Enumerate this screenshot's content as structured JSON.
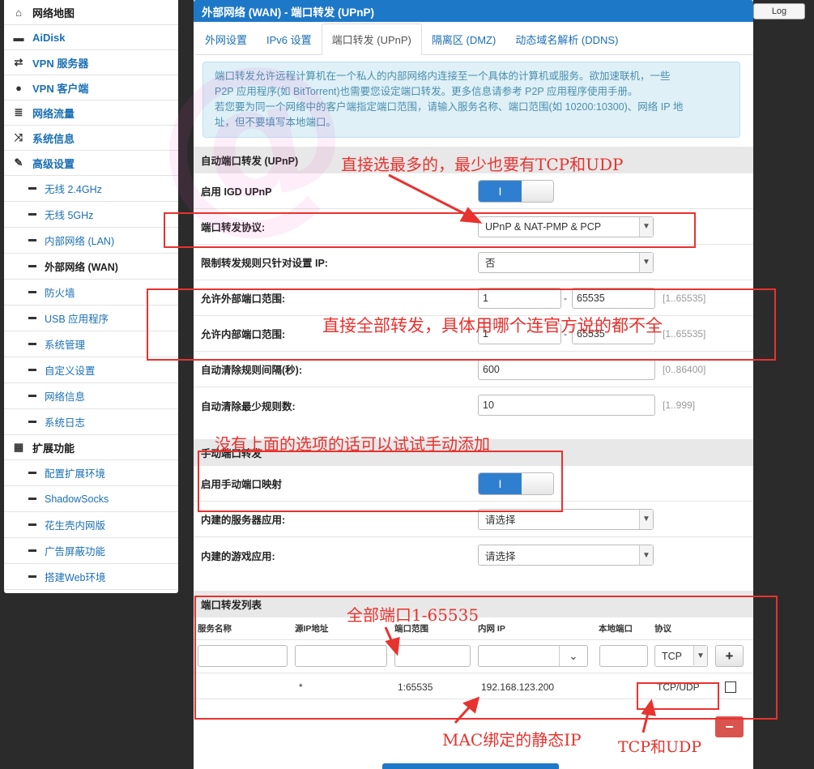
{
  "header": {
    "title": "外部网络 (WAN) - 端口转发 (UPnP)",
    "logout_label": "Log"
  },
  "sidebar": {
    "items": [
      {
        "icon": "home-icon",
        "label": "网络地图"
      },
      {
        "icon": "drive-icon",
        "label": "AiDisk"
      },
      {
        "icon": "vpn-icon",
        "label": "VPN 服务器"
      },
      {
        "icon": "globe-icon",
        "label": "VPN 客户端"
      },
      {
        "icon": "traffic-icon",
        "label": "网络流量"
      },
      {
        "icon": "shuffle-icon",
        "label": "系统信息"
      },
      {
        "icon": "wrench-icon",
        "label": "高级设置"
      }
    ],
    "advanced_sub": [
      "无线 2.4GHz",
      "无线 5GHz",
      "内部网络 (LAN)",
      "外部网络 (WAN)",
      "防火墙",
      "USB 应用程序",
      "系统管理",
      "自定义设置",
      "网络信息",
      "系统日志"
    ],
    "ext_label": "扩展功能",
    "ext_sub": [
      "配置扩展环境",
      "ShadowSocks",
      "花生壳内网版",
      "广告屏蔽功能",
      "搭建Web环境"
    ]
  },
  "tabs": [
    "外网设置",
    "IPv6 设置",
    "端口转发 (UPnP)",
    "隔离区 (DMZ)",
    "动态域名解析 (DDNS)"
  ],
  "info": {
    "line1": "端口转发允许远程计算机在一个私人的内部网络内连接至一个具体的计算机或服务。欲加速联机，一些",
    "line2": "P2P 应用程序(如 BitTorrent)也需要您设定端口转发。更多信息请参考 P2P 应用程序使用手册。",
    "line3": "若您要为同一个网络中的客户端指定端口范围，请输入服务名称、端口范围(如 10200:10300)、网络 IP 地",
    "line4": "址，但不要填写本地端口。"
  },
  "upnp": {
    "section": "自动端口转发 (UPnP)",
    "enable_label": "启用 IGD UPnP",
    "toggle_on": "I",
    "protocol_label": "端口转发协议:",
    "protocol_value": "UPnP & NAT-PMP & PCP",
    "restrict_label": "限制转发规则只针对设置 IP:",
    "restrict_value": "否",
    "ext_range_label": "允许外部端口范围:",
    "ext_from": "1",
    "ext_to": "65535",
    "int_range_label": "允许内部端口范围:",
    "int_from": "1",
    "int_to": "65535",
    "range_hint": "[1..65535]",
    "dash": "-",
    "clean_interval_label": "自动清除规则间隔(秒):",
    "clean_interval": "600",
    "clean_interval_hint": "[0..86400]",
    "clean_min_label": "自动清除最少规则数:",
    "clean_min": "10",
    "clean_min_hint": "[1..999]"
  },
  "manual": {
    "section": "手动端口转发",
    "enable_label": "启用手动端口映射",
    "builtin_service_label": "内建的服务器应用:",
    "builtin_game_label": "内建的游戏应用:",
    "placeholder_select": "请选择"
  },
  "forward_list": {
    "section": "端口转发列表",
    "columns": [
      "服务名称",
      "源IP地址",
      "端口范围",
      "内网 IP",
      "本地端口",
      "协议"
    ],
    "proto_default": "TCP",
    "add_symbol": "+",
    "remove_symbol": "−",
    "rows": [
      {
        "service": "",
        "src_ip": "*",
        "port_range": "1:65535",
        "lan_ip": "192.168.123.200",
        "local_port": "",
        "protocol": "TCP/UDP"
      }
    ]
  },
  "annotations": {
    "a1": "直接选最多的，最少也要有TCP和UDP",
    "a2": "直接全部转发，具体用哪个连官方说的都不全",
    "a3": "没有上面的选项的话可以试试手动添加",
    "a4": "全部端口1-65535",
    "a5": "MAC绑定的静态IP",
    "a6": "TCP和UDP"
  },
  "colors": {
    "accent": "#1e78c8",
    "annotation": "#e8322e"
  }
}
